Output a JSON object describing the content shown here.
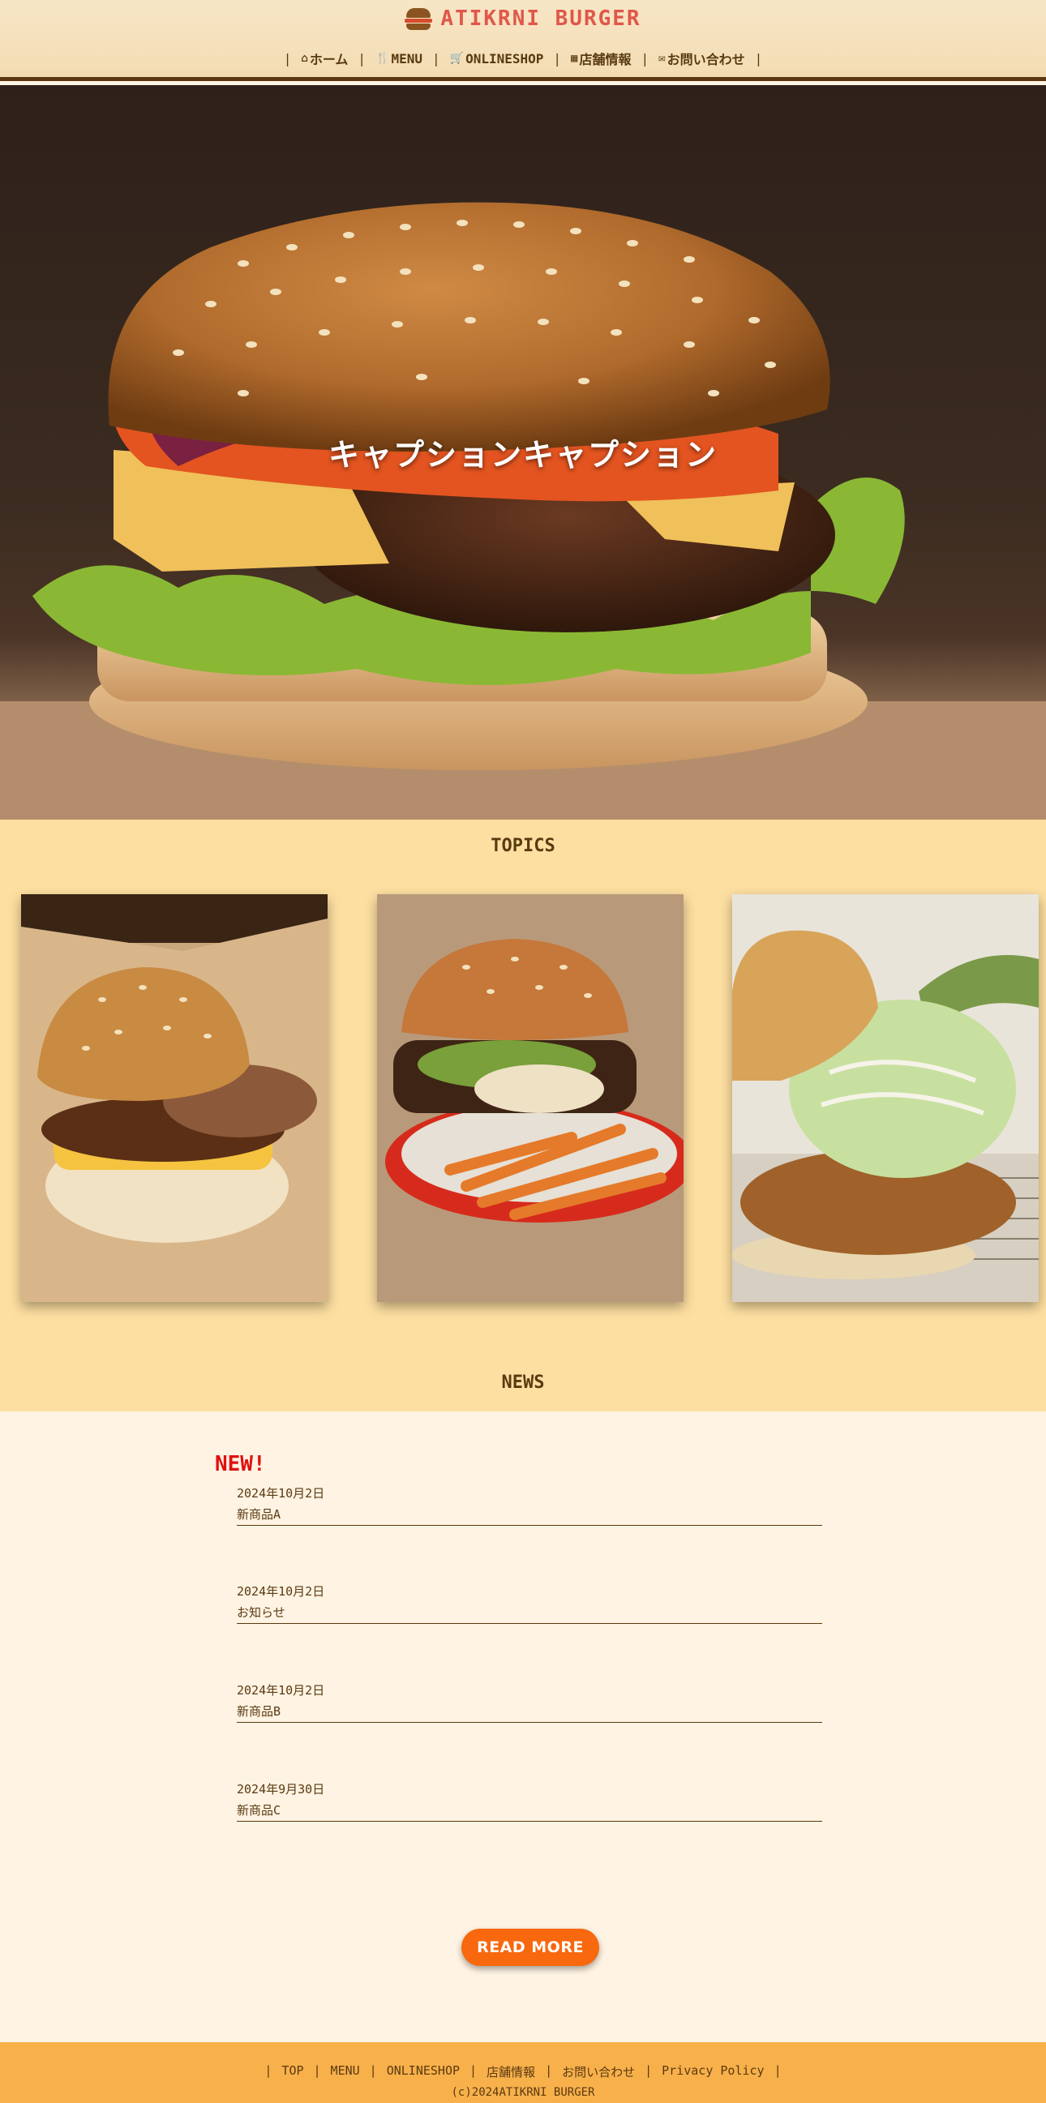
{
  "header": {
    "logo_text": "ATIKRNI BURGER",
    "nav": [
      {
        "icon": "home-icon",
        "glyph": "⌂",
        "label": "ホーム"
      },
      {
        "icon": "fork-knife-icon",
        "glyph": "🍴",
        "label": "MENU"
      },
      {
        "icon": "basket-icon",
        "glyph": "🛒",
        "label": "ONLINESHOP"
      },
      {
        "icon": "building-icon",
        "glyph": "▦",
        "label": "店舗情報"
      },
      {
        "icon": "envelope-icon",
        "glyph": "✉",
        "label": "お問い合わせ"
      }
    ]
  },
  "hero": {
    "caption": "キャプションキャプション"
  },
  "topics": {
    "title": "TOPICS"
  },
  "news": {
    "title": "NEWS",
    "new_badge": "NEW!",
    "items": [
      {
        "date": "2024年10月2日",
        "title": "新商品A"
      },
      {
        "date": "2024年10月2日",
        "title": "お知らせ"
      },
      {
        "date": "2024年10月2日",
        "title": "新商品B"
      },
      {
        "date": "2024年9月30日",
        "title": "新商品C"
      }
    ],
    "read_more": "READ MORE"
  },
  "footer": {
    "links": [
      "TOP",
      "MENU",
      "ONLINESHOP",
      "店舗情報",
      "お問い合わせ",
      "Privacy Policy"
    ],
    "copyright": "(c)2024ATIKRNI BURGER"
  },
  "colors": {
    "header_bg": "#f3dcb3",
    "logo": "#e0574a",
    "topics_bg": "#fddfa1",
    "news_bg": "#fff3e3",
    "new_badge": "#e01010",
    "read_more": "#f8680e",
    "footer_bg": "#f8b04b",
    "text": "#5a3a10"
  }
}
